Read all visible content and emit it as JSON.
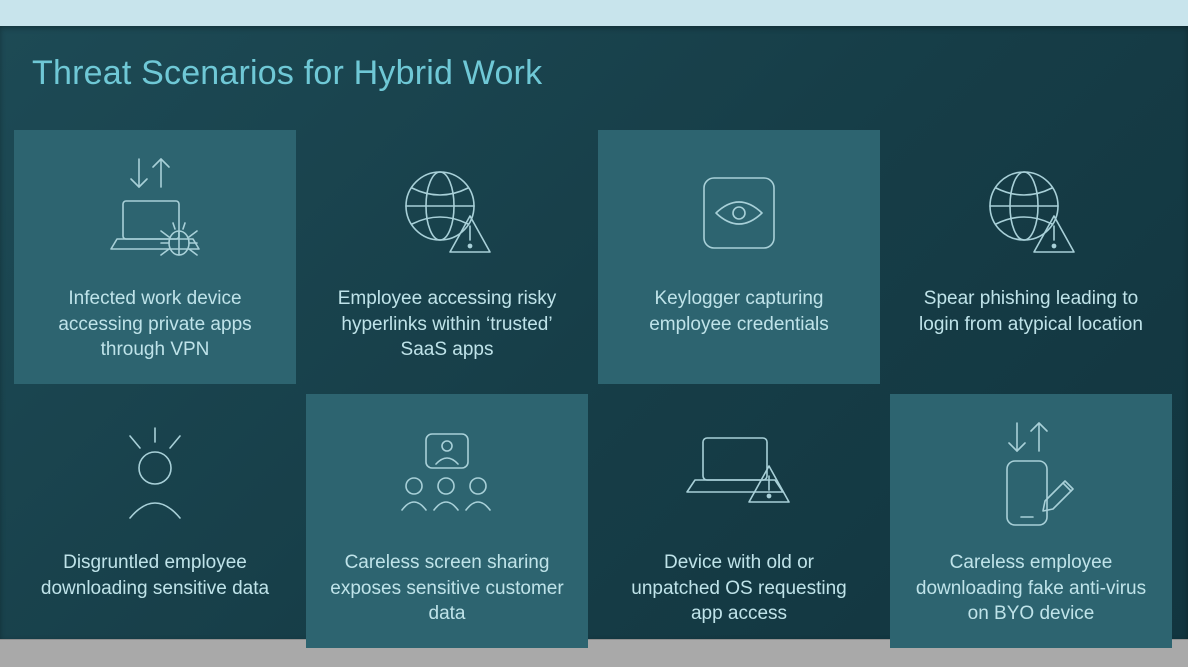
{
  "title": "Threat Scenarios for Hybrid Work",
  "cards": [
    {
      "icon": "laptop-bug",
      "highlight": true,
      "caption": "Infected work device accessing private apps through VPN"
    },
    {
      "icon": "globe-alert",
      "highlight": false,
      "caption": "Employee accessing risky hyperlinks within ‘trusted’ SaaS apps"
    },
    {
      "icon": "eye-box",
      "highlight": true,
      "caption": "Keylogger capturing employee credentials"
    },
    {
      "icon": "globe-alert",
      "highlight": false,
      "caption": "Spear phishing leading to login from atypical location"
    },
    {
      "icon": "angry-user",
      "highlight": false,
      "caption": "Disgruntled employee downloading sensitive data"
    },
    {
      "icon": "screen-share",
      "highlight": true,
      "caption": "Careless screen sharing exposes sensitive customer data"
    },
    {
      "icon": "laptop-alert",
      "highlight": false,
      "caption": "Device with old or unpatched OS requesting app access"
    },
    {
      "icon": "phone-download",
      "highlight": true,
      "caption": "Careless employee downloading fake anti-virus on BYO device"
    }
  ]
}
